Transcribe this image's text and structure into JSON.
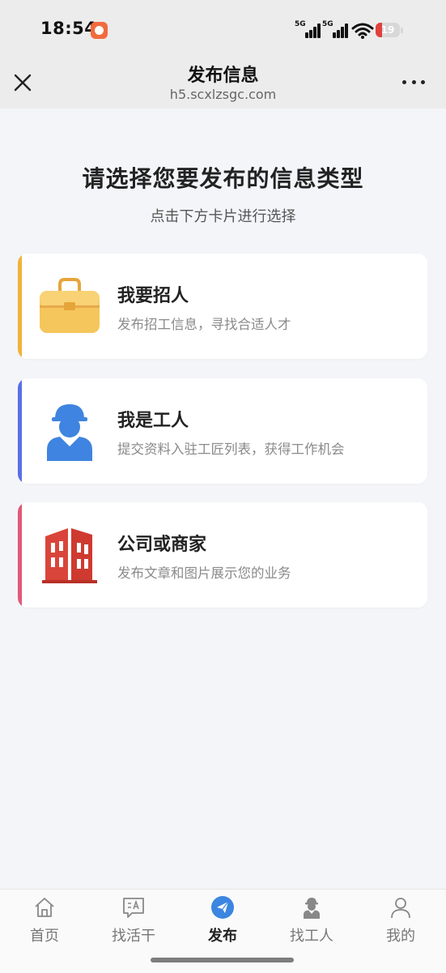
{
  "status_bar": {
    "time": "18:54",
    "signal1": "5G",
    "signal2": "5G",
    "battery": "19",
    "battery_color": "#e0413c"
  },
  "header": {
    "title": "发布信息",
    "url": "h5.scxlzsgc.com",
    "close_icon": "close-icon",
    "more_icon": "more-icon"
  },
  "main": {
    "heading": "请选择您要发布的信息类型",
    "subheading": "点击下方卡片进行选择",
    "cards": [
      {
        "title": "我要招人",
        "desc": "发布招工信息，寻找合适人才",
        "icon": "briefcase-icon",
        "accent": "#f0b33a"
      },
      {
        "title": "我是工人",
        "desc": "提交资料入驻工匠列表，获得工作机会",
        "icon": "worker-icon",
        "accent": "#5b6ee8"
      },
      {
        "title": "公司或商家",
        "desc": "发布文章和图片展示您的业务",
        "icon": "building-icon",
        "accent": "#e05a7a"
      }
    ]
  },
  "tabbar": {
    "active_color": "#3b86e0",
    "tabs": [
      {
        "label": "首页",
        "icon": "home-icon"
      },
      {
        "label": "找活干",
        "icon": "message-icon"
      },
      {
        "label": "发布",
        "icon": "send-icon",
        "active": true
      },
      {
        "label": "找工人",
        "icon": "worker-icon"
      },
      {
        "label": "我的",
        "icon": "person-icon"
      }
    ]
  }
}
